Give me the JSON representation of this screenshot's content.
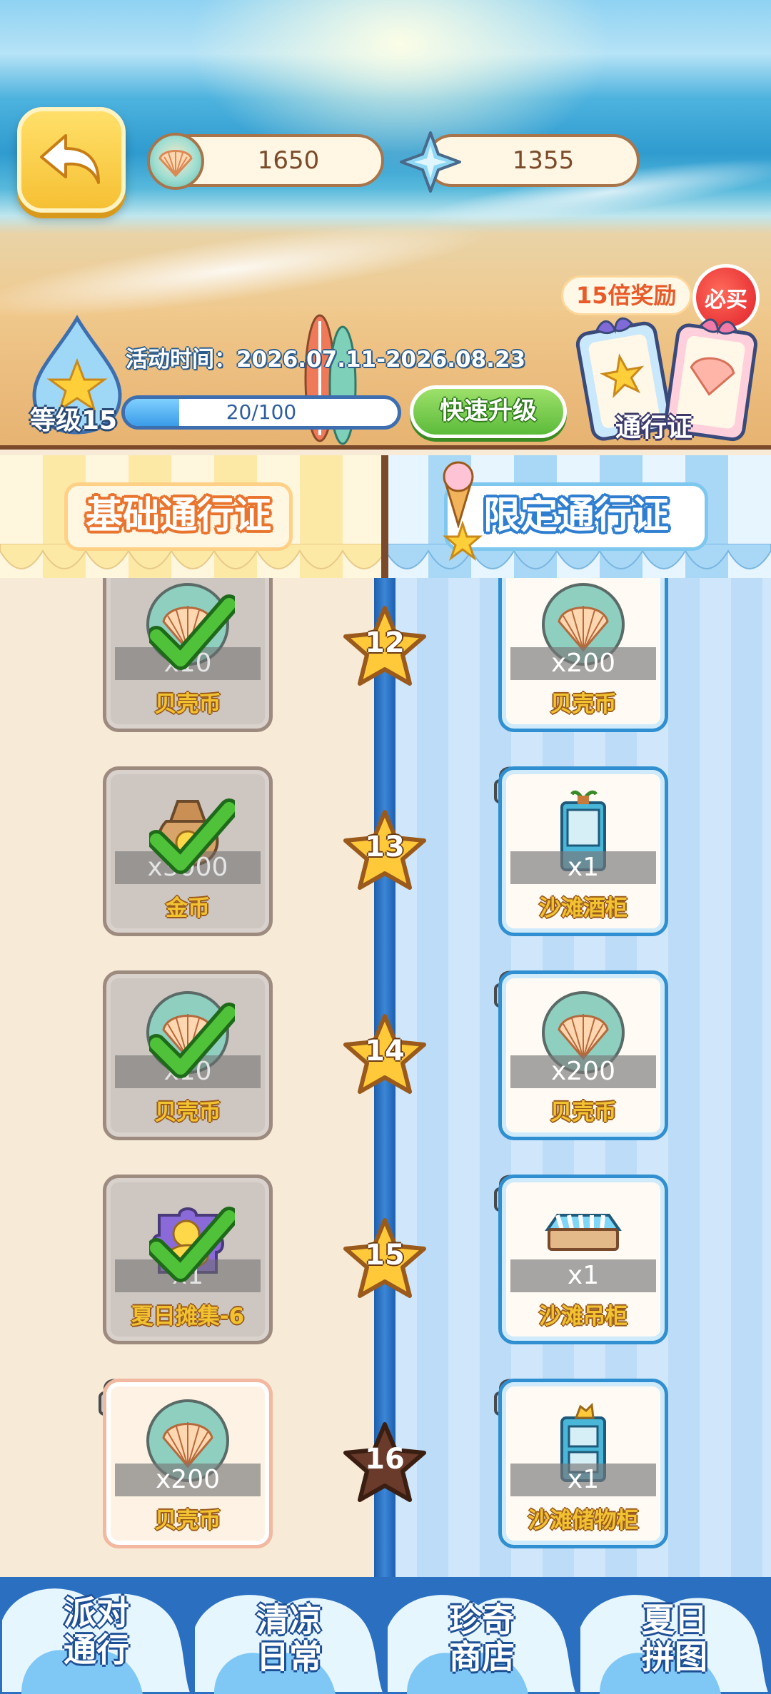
{
  "header": {
    "shell_coins": "1650",
    "gems": "1355",
    "reward_tag": "15倍奖励",
    "must_buy": "必买",
    "pass_label": "通行证",
    "event_time": "活动时间：2026.07.11-2026.08.23",
    "level_label": "等级15",
    "xp_text": "20/100",
    "xp_progress": 0.2,
    "upgrade_label": "快速升级"
  },
  "columns": {
    "basic_title": "基础通行证",
    "limited_title": "限定通行证"
  },
  "rows": [
    {
      "level": "12",
      "basic": {
        "qty": "x10",
        "name": "贝壳币",
        "claimed": true,
        "icon": "shell-coin-icon"
      },
      "premium": {
        "qty": "x200",
        "name": "贝壳币",
        "locked": true,
        "icon": "shell-coin-icon"
      }
    },
    {
      "level": "13",
      "basic": {
        "qty": "x3000",
        "name": "金币",
        "claimed": true,
        "icon": "gold-coin-bag-icon"
      },
      "premium": {
        "qty": "x1",
        "name": "沙滩酒柜",
        "locked": true,
        "icon": "beach-wine-cabinet-icon"
      }
    },
    {
      "level": "14",
      "basic": {
        "qty": "x10",
        "name": "贝壳币",
        "claimed": true,
        "icon": "shell-coin-icon"
      },
      "premium": {
        "qty": "x200",
        "name": "贝壳币",
        "locked": true,
        "icon": "shell-coin-icon"
      }
    },
    {
      "level": "15",
      "basic": {
        "qty": "x1",
        "name": "夏日摊集-6",
        "claimed": true,
        "icon": "duck-puzzle-icon"
      },
      "premium": {
        "qty": "x1",
        "name": "沙滩吊柜",
        "locked": true,
        "icon": "beach-hanging-cabinet-icon"
      }
    },
    {
      "level": "16",
      "basic": {
        "qty": "x200",
        "name": "贝壳币",
        "claimed": false,
        "locked": true,
        "icon": "shell-coin-icon"
      },
      "premium": {
        "qty": "x1",
        "name": "沙滩储物柜",
        "locked": true,
        "icon": "beach-storage-cabinet-icon"
      }
    }
  ],
  "tabs": [
    {
      "line1": "派对",
      "line2": "通行"
    },
    {
      "line1": "清凉",
      "line2": "日常"
    },
    {
      "line1": "珍奇",
      "line2": "商店"
    },
    {
      "line1": "夏日",
      "line2": "拼图"
    }
  ],
  "colors": {
    "accent_blue": "#2f8fd0",
    "accent_orange": "#e8742e",
    "gold_text": "#f2c331",
    "green_button": "#5cbb3a"
  }
}
